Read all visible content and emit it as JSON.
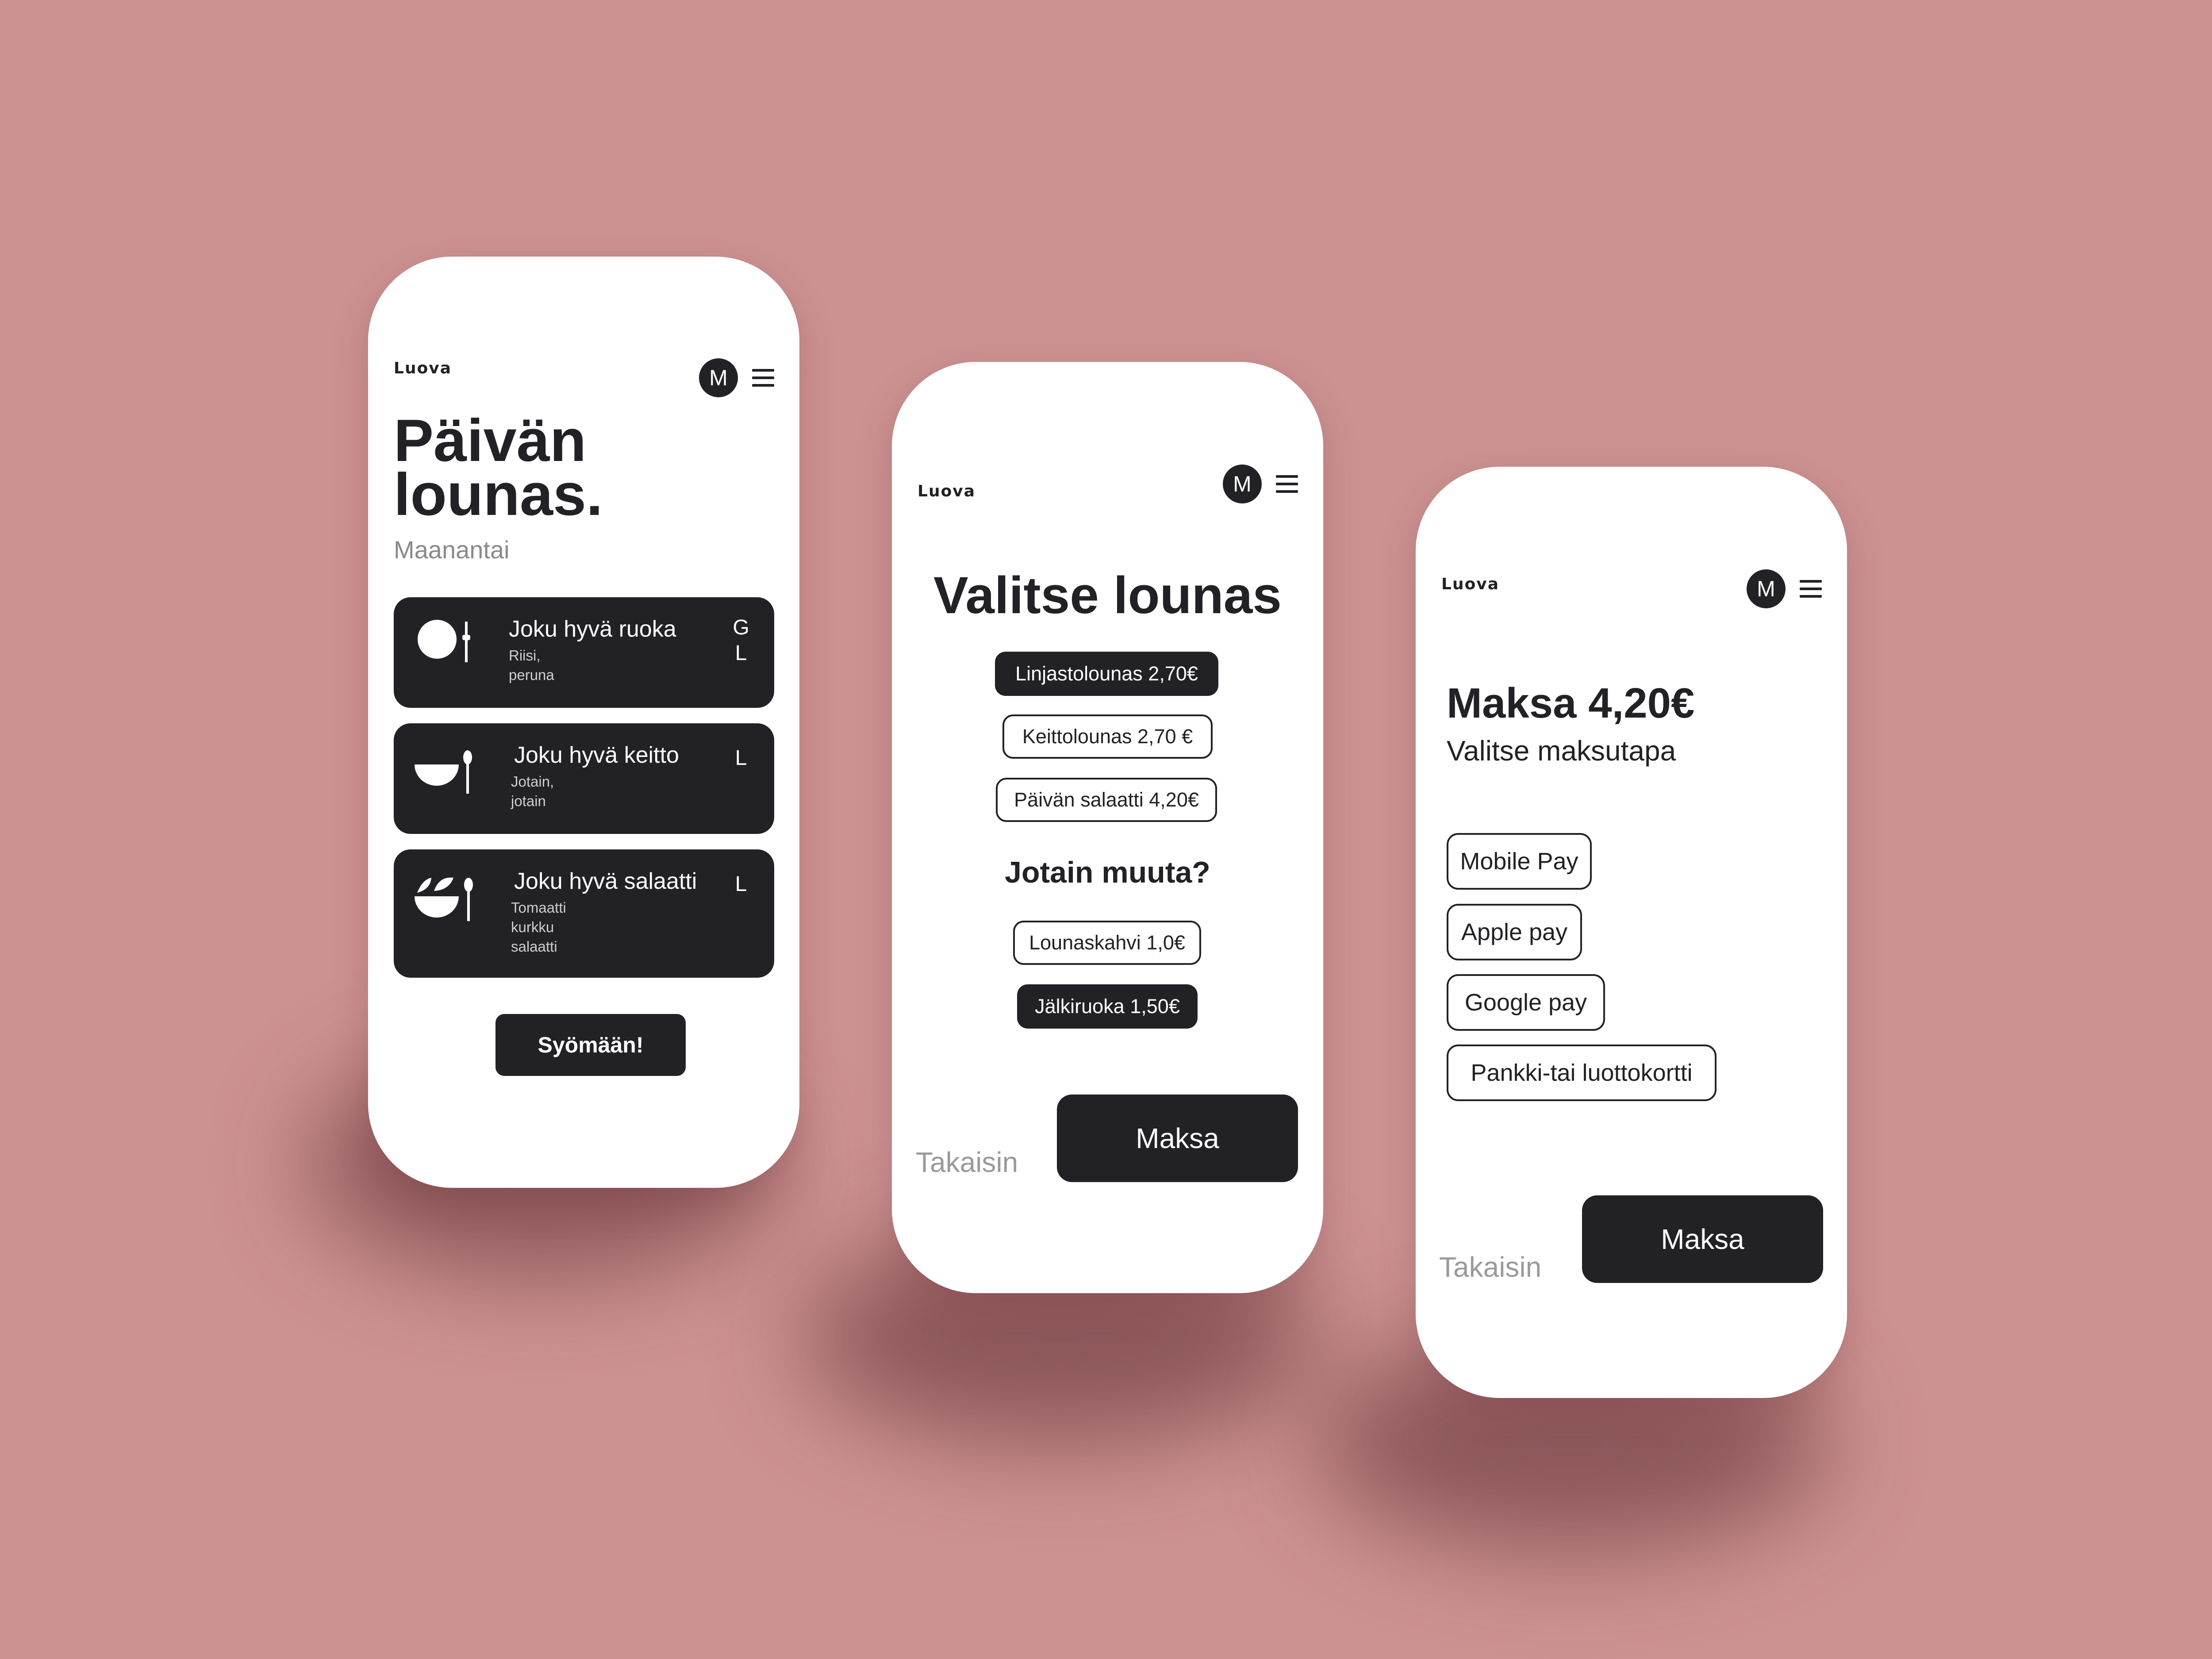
{
  "colors": {
    "background": "#cc9191",
    "ink": "#222226",
    "muted": "#8a8a8a",
    "card_text": "#ffffff"
  },
  "screen1": {
    "brand": "Luova",
    "avatar": "M",
    "title_line1": "Päivän",
    "title_line2": "lounas.",
    "subtitle": "Maanantai",
    "meals": [
      {
        "icon": "plate-icon",
        "name": "Joku hyvä ruoka",
        "desc1": "Riisi,",
        "desc2": "peruna",
        "desc3": "",
        "tag1": "G",
        "tag2": "L"
      },
      {
        "icon": "soup-bowl-icon",
        "name": "Joku hyvä keitto",
        "desc1": "Jotain,",
        "desc2": "jotain",
        "desc3": "",
        "tag1": "L",
        "tag2": ""
      },
      {
        "icon": "salad-bowl-icon",
        "name": "Joku hyvä salaatti",
        "desc1": "Tomaatti",
        "desc2": "kurkku",
        "desc3": "salaatti",
        "tag1": "L",
        "tag2": ""
      }
    ],
    "cta": "Syömään!"
  },
  "screen2": {
    "brand": "Luova",
    "avatar": "M",
    "title": "Valitse lounas",
    "options": [
      {
        "label": "Linjastolounas 2,70€",
        "selected": true
      },
      {
        "label": "Keittolounas 2,70 €",
        "selected": false
      },
      {
        "label": "Päivän salaatti 4,20€",
        "selected": false
      }
    ],
    "extras_title": "Jotain muuta?",
    "extras": [
      {
        "label": "Lounaskahvi 1,0€",
        "selected": false
      },
      {
        "label": "Jälkiruoka 1,50€",
        "selected": true
      }
    ],
    "back": "Takaisin",
    "pay": "Maksa"
  },
  "screen3": {
    "brand": "Luova",
    "avatar": "M",
    "title": "Maksa 4,20€",
    "subtitle": "Valitse maksutapa",
    "methods": [
      "Mobile Pay",
      "Apple pay",
      "Google pay",
      "Pankki-tai luottokortti"
    ],
    "back": "Takaisin",
    "pay": "Maksa"
  }
}
